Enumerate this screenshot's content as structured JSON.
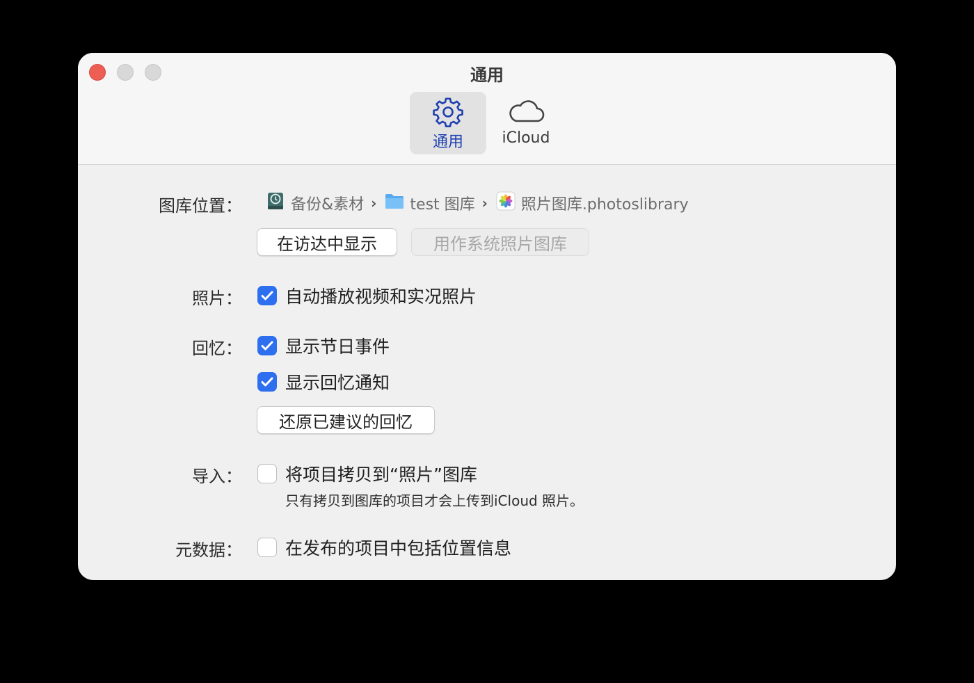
{
  "window": {
    "title": "通用",
    "tabs": [
      {
        "label": "通用",
        "icon": "gear-icon",
        "active": true
      },
      {
        "label": "iCloud",
        "icon": "cloud-icon",
        "active": false
      }
    ]
  },
  "library": {
    "label": "图库位置：",
    "path": [
      {
        "text": "备份&素材",
        "icon": "time-machine-drive-icon"
      },
      {
        "text": "test 图库",
        "icon": "folder-icon"
      },
      {
        "text": "照片图库.photoslibrary",
        "icon": "photos-app-icon"
      }
    ],
    "show_in_finder": "在访达中显示",
    "use_as_system": "用作系统照片图库"
  },
  "photos": {
    "label": "照片：",
    "autoplay": {
      "label": "自动播放视频和实况照片",
      "checked": true
    }
  },
  "memories": {
    "label": "回忆：",
    "holiday": {
      "label": "显示节日事件",
      "checked": true
    },
    "notify": {
      "label": "显示回忆通知",
      "checked": true
    },
    "reset": "还原已建议的回忆"
  },
  "import": {
    "label": "导入：",
    "copy": {
      "label": "将项目拷贝到“照片”图库",
      "checked": false
    },
    "note": "只有拷贝到图库的项目才会上传到iCloud 照片。"
  },
  "metadata": {
    "label": "元数据：",
    "location": {
      "label": "在发布的项目中包括位置信息",
      "checked": false
    }
  },
  "colors": {
    "accent": "#2e6ff0",
    "selected_tab_text": "#1d3fb0",
    "close": "#ed5f55"
  }
}
